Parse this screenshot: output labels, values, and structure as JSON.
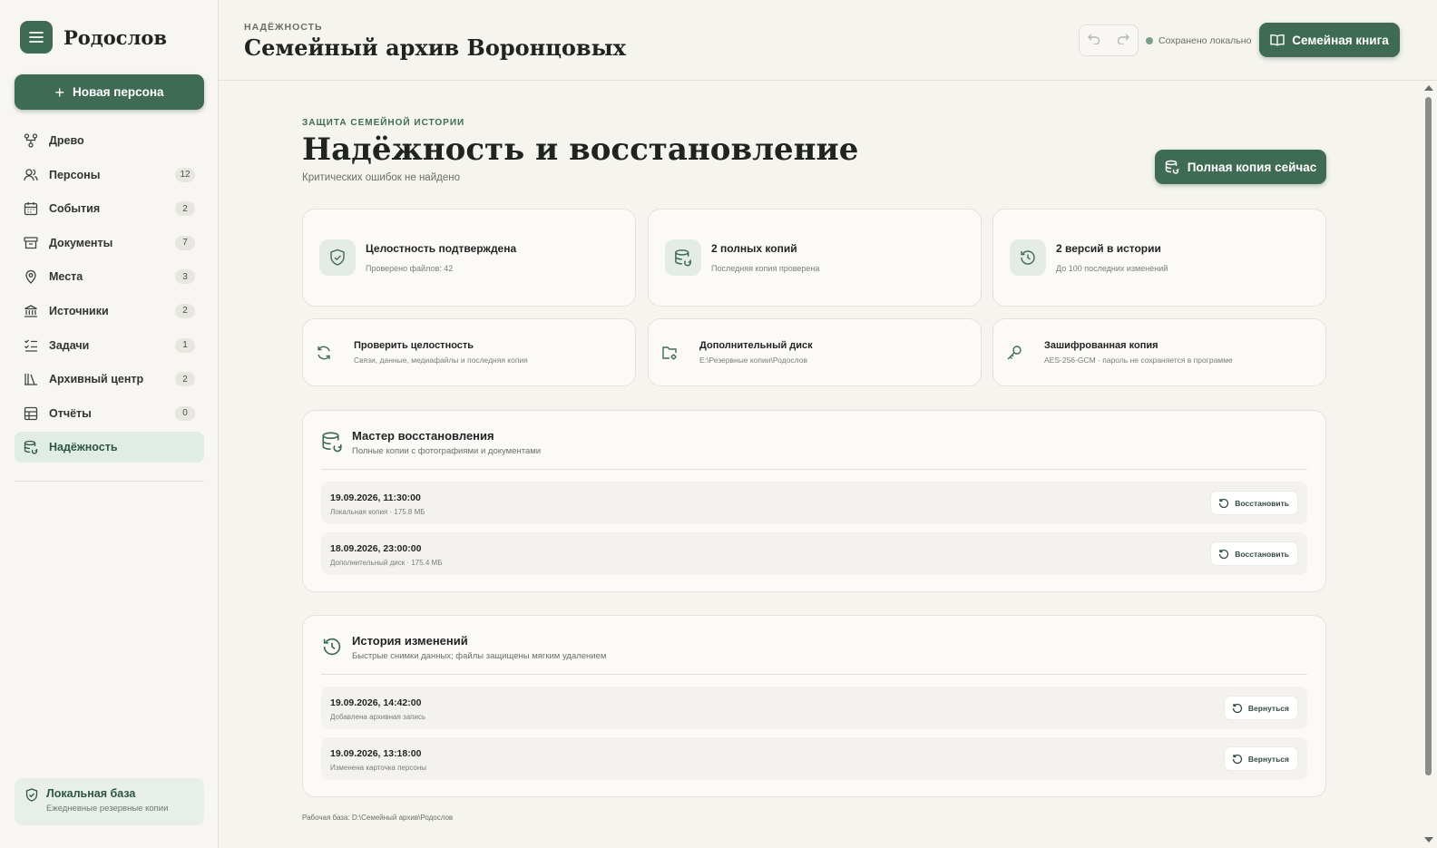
{
  "app": {
    "name": "Родослов"
  },
  "sidebar": {
    "new_button": "Новая персона",
    "items": [
      {
        "icon": "tree-icon",
        "label": "Древо",
        "badge": ""
      },
      {
        "icon": "people-icon",
        "label": "Персоны",
        "badge": "12"
      },
      {
        "icon": "calendar-icon",
        "label": "События",
        "badge": "2"
      },
      {
        "icon": "archive-box-icon",
        "label": "Документы",
        "badge": "7"
      },
      {
        "icon": "map-pin-icon",
        "label": "Места",
        "badge": "3"
      },
      {
        "icon": "bank-icon",
        "label": "Источники",
        "badge": "2"
      },
      {
        "icon": "checklist-icon",
        "label": "Задачи",
        "badge": "1"
      },
      {
        "icon": "library-icon",
        "label": "Архивный центр",
        "badge": "2"
      },
      {
        "icon": "table-icon",
        "label": "Отчёты",
        "badge": "0"
      },
      {
        "icon": "database-icon",
        "label": "Надёжность",
        "badge": "",
        "active": true
      }
    ],
    "footer": {
      "title": "Локальная база",
      "subtitle": "Ежедневные резервные копии"
    }
  },
  "header": {
    "eyebrow": "НАДЁЖНОСТЬ",
    "title": "Семейный архив Воронцовых",
    "saved_status": "Сохранено локально",
    "book_button": "Семейная книга"
  },
  "main": {
    "eyebrow": "ЗАЩИТА СЕМЕЙНОЙ ИСТОРИИ",
    "title": "Надёжность и восстановление",
    "subtitle": "Критических ошибок не найдено",
    "full_copy_button": "Полная копия сейчас",
    "stats": [
      {
        "icon": "shield-check-icon",
        "title": "Целостность подтверждена",
        "subtitle": "Проверено файлов: 42"
      },
      {
        "icon": "database-restore-icon",
        "title": "2 полных копий",
        "subtitle": "Последняя копия проверена"
      },
      {
        "icon": "history-icon",
        "title": "2 версий в истории",
        "subtitle": "До 100 последних изменений"
      }
    ],
    "actions": [
      {
        "icon": "refresh-icon",
        "title": "Проверить целостность",
        "subtitle": "Связи, данные, медиафайлы и последняя копия"
      },
      {
        "icon": "folder-settings-icon",
        "title": "Дополнительный диск",
        "subtitle": "E:\\Резервные копии\\Родослов"
      },
      {
        "icon": "key-icon",
        "title": "Зашифрованная копия",
        "subtitle": "AES-256-GCM · пароль не сохраняется в программе"
      }
    ],
    "restore": {
      "title": "Мастер восстановления",
      "subtitle": "Полные копии с фотографиями и документами",
      "rows": [
        {
          "date": "19.09.2026, 11:30:00",
          "meta": "Локальная копия · 175.8 МБ",
          "action": "Восстановить"
        },
        {
          "date": "18.09.2026, 23:00:00",
          "meta": "Дополнительный диск · 175.4 МБ",
          "action": "Восстановить"
        }
      ]
    },
    "history": {
      "title": "История изменений",
      "subtitle": "Быстрые снимки данных; файлы защищены мягким удалением",
      "rows": [
        {
          "date": "19.09.2026, 14:42:00",
          "meta": "Добавлена архивная запись",
          "action": "Вернуться"
        },
        {
          "date": "19.09.2026, 13:18:00",
          "meta": "Изменена карточка персоны",
          "action": "Вернуться"
        }
      ]
    },
    "footnote": "Рабочая база: D:\\Семейный архив\\Родослов"
  },
  "colors": {
    "accent": "#3f6b55",
    "background": "#f5f4ef",
    "card": "#fbfaf8"
  }
}
